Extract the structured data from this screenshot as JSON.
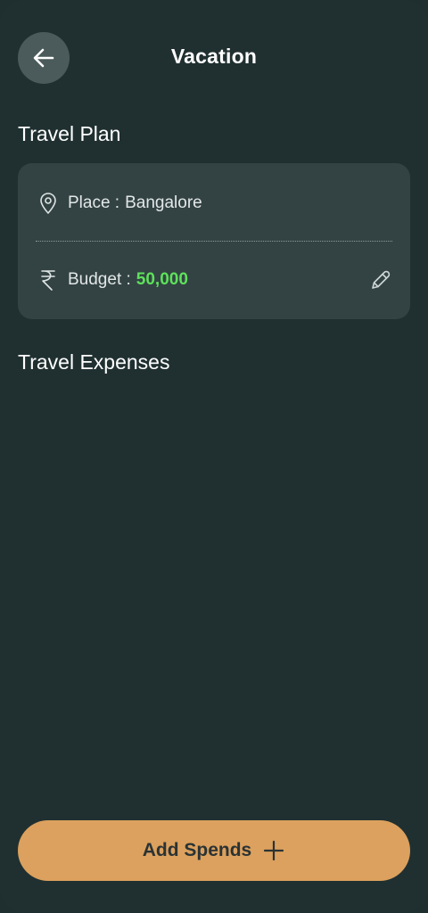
{
  "header": {
    "back_icon": "arrow-left-icon",
    "title": "Vacation"
  },
  "travel_plan": {
    "title": "Travel Plan",
    "place_label": "Place :",
    "place_value": "Bangalore",
    "budget_label": "Budget :",
    "budget_value": "50,000",
    "budget_color": "#5ee15a",
    "icons": [
      "location-pin-icon",
      "rupee-icon",
      "pencil-icon"
    ]
  },
  "travel_expenses": {
    "title": "Travel Expenses"
  },
  "footer": {
    "add_label": "Add Spends",
    "add_icon": "plus-icon",
    "accent": "#dca15e"
  }
}
